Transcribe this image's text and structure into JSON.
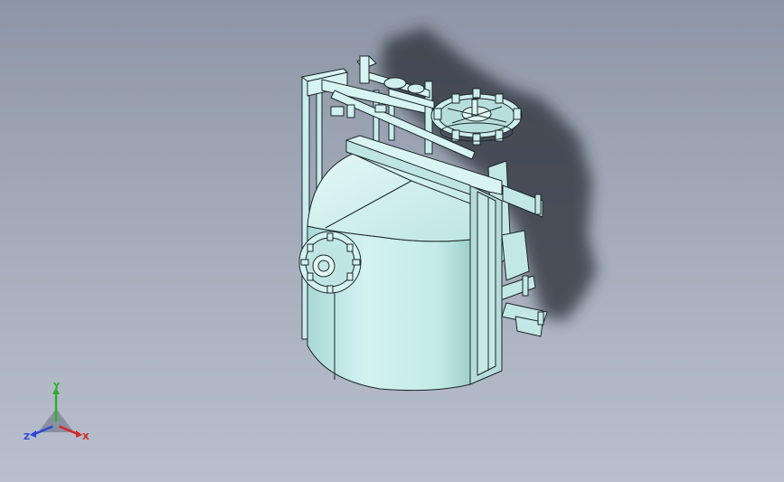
{
  "viewport": {
    "background_top": "#8d96a6",
    "background_bottom": "#b9bfcc"
  },
  "model": {
    "body_color": "#c9eeec",
    "edge_color": "#1c2628",
    "shadow_color": "#2a2f38"
  },
  "triad": {
    "axes": [
      {
        "label": "Y",
        "color": "#2fae2f"
      },
      {
        "label": "X",
        "color": "#d22828"
      },
      {
        "label": "Z",
        "color": "#2a48d6"
      }
    ],
    "icons": [
      "view-triad-icon"
    ]
  }
}
